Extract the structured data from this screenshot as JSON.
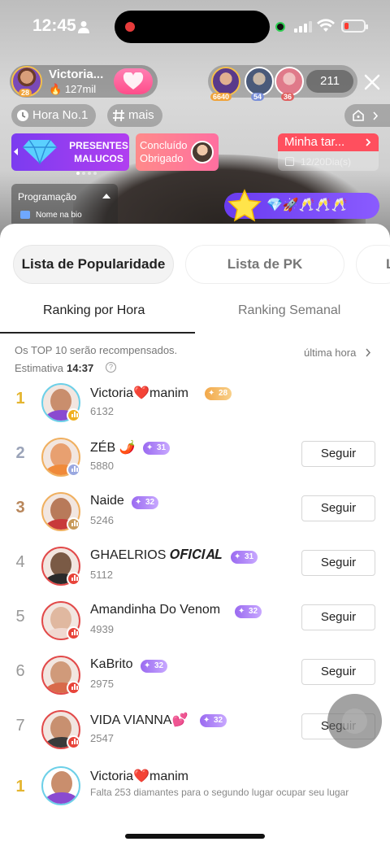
{
  "status_bar": {
    "time": "12:45"
  },
  "host": {
    "name": "Victoria...",
    "level": "28",
    "fans": "127mil"
  },
  "viewers": {
    "avatars": [
      {
        "count": "6640",
        "badge_color": "#f0a33a"
      },
      {
        "count": "54",
        "badge_color": "#7a8fd8"
      },
      {
        "count": "36",
        "badge_color": "#e06060"
      }
    ],
    "total": "211"
  },
  "tags": {
    "hour_rank": "Hora No.1",
    "more": "mais"
  },
  "banners": {
    "crazy_gifts": "PRESENTES MALUCOS",
    "thanks": "Concluído Obrigado",
    "task_title": "Minha tar...",
    "task_progress": "12/20Dia(s)"
  },
  "program": {
    "title": "Programação",
    "subtitle": "Nome na bio"
  },
  "gift_bar": {
    "items": "💎🚀🥂🥂🥂"
  },
  "sheet": {
    "tabs": [
      "Lista de Popularidade",
      "Lista de PK",
      "L"
    ],
    "subtabs": [
      "Ranking por Hora",
      "Ranking Semanal"
    ],
    "notice": "Os TOP 10 serão recompensados.",
    "last_hour": "última hora",
    "estimate_label": "Estimativa",
    "estimate_time": "14:37"
  },
  "ranking": [
    {
      "rank": "1",
      "name": "Victoria❤️manim",
      "level": "28",
      "score": "6132",
      "follow": ""
    },
    {
      "rank": "2",
      "name": "ZÉB 🌶️",
      "level": "31",
      "score": "5880",
      "follow": "Seguir"
    },
    {
      "rank": "3",
      "name": "Naide",
      "level": "32",
      "score": "5246",
      "follow": "Seguir"
    },
    {
      "rank": "4",
      "name": "GHAELRIOS 𝑶𝑭𝑰𝑪𝑰𝑨𝑳",
      "level": "31",
      "score": "5112",
      "follow": "Seguir"
    },
    {
      "rank": "5",
      "name": "Amandinha Do Venom",
      "level": "32",
      "score": "4939",
      "follow": "Seguir"
    },
    {
      "rank": "6",
      "name": "KaBrito",
      "level": "32",
      "score": "2975",
      "follow": "Seguir"
    },
    {
      "rank": "7",
      "name": "VIDA VIANNA💕",
      "level": "32",
      "score": "2547",
      "follow": "Seguir"
    }
  ],
  "me": {
    "rank": "1",
    "name": "Victoria❤️manim",
    "message": "Falta 253 diamantes para o segundo lugar ocupar seu lugar"
  },
  "colors": {
    "gold": "#e4b530",
    "silver": "#9aa3b8",
    "bronze": "#b8865a",
    "level_gold": "#f2b85a",
    "level_purple": "#a77bf5",
    "live_red": "#e8443a"
  }
}
